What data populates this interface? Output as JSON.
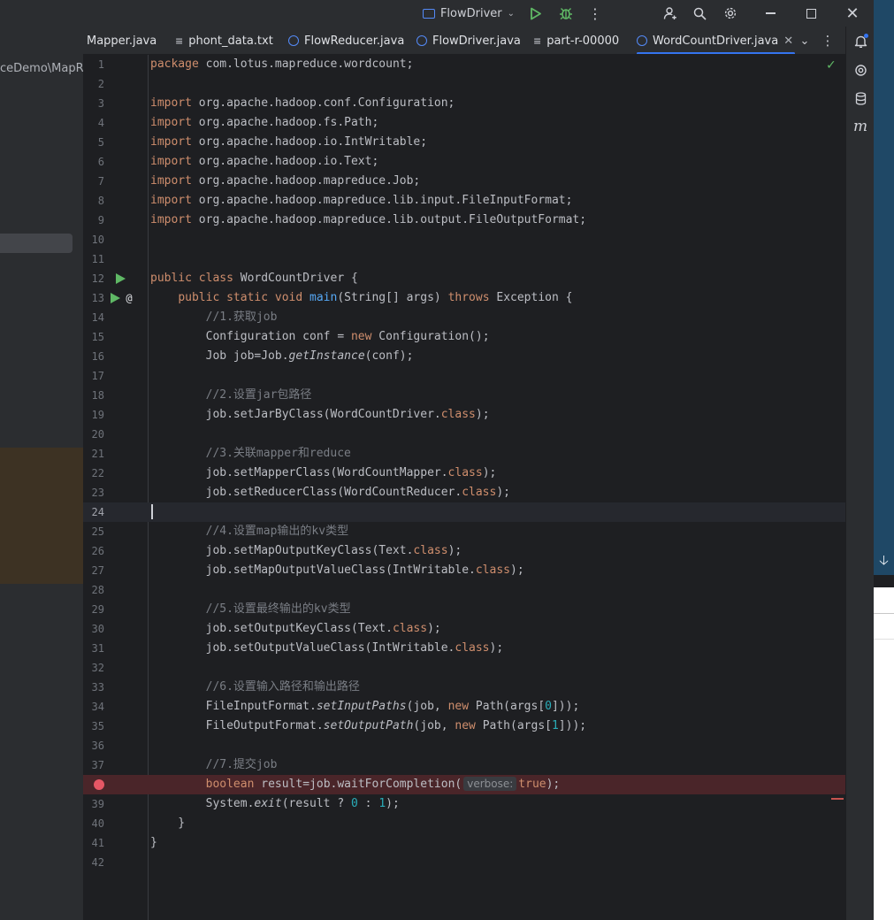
{
  "titlebar": {
    "run_config": "FlowDriver",
    "icons": [
      "run-icon",
      "debug-icon",
      "more-icon",
      "add-user-icon",
      "search-icon",
      "settings-icon",
      "minimize-icon",
      "maximize-icon",
      "close-icon"
    ]
  },
  "project": {
    "path_fragment": "ceDemo\\MapRe"
  },
  "tabs": [
    {
      "label": "Mapper.java",
      "icon": "java-class-icon",
      "active": false
    },
    {
      "label": "phont_data.txt",
      "icon": "text-file-icon",
      "active": false
    },
    {
      "label": "FlowReducer.java",
      "icon": "java-class-icon",
      "active": false
    },
    {
      "label": "FlowDriver.java",
      "icon": "java-class-icon",
      "active": false
    },
    {
      "label": "part-r-00000",
      "icon": "text-file-icon",
      "active": false
    },
    {
      "label": "WordCountDriver.java",
      "icon": "java-class-icon",
      "active": true
    }
  ],
  "editor": {
    "caret_line": 24,
    "breakpoint_line": 38,
    "lines": [
      {
        "n": "1",
        "tokens": [
          [
            "kw",
            "package"
          ],
          [
            "pl",
            " com.lotus.mapreduce.wordcount;"
          ]
        ]
      },
      {
        "n": "2",
        "tokens": []
      },
      {
        "n": "3",
        "tokens": [
          [
            "kw",
            "import"
          ],
          [
            "pl",
            " org.apache.hadoop.conf.Configuration;"
          ]
        ]
      },
      {
        "n": "4",
        "tokens": [
          [
            "kw",
            "import"
          ],
          [
            "pl",
            " org.apache.hadoop.fs.Path;"
          ]
        ]
      },
      {
        "n": "5",
        "tokens": [
          [
            "kw",
            "import"
          ],
          [
            "pl",
            " org.apache.hadoop.io.IntWritable;"
          ]
        ]
      },
      {
        "n": "6",
        "tokens": [
          [
            "kw",
            "import"
          ],
          [
            "pl",
            " org.apache.hadoop.io.Text;"
          ]
        ]
      },
      {
        "n": "7",
        "tokens": [
          [
            "kw",
            "import"
          ],
          [
            "pl",
            " org.apache.hadoop.mapreduce.Job;"
          ]
        ]
      },
      {
        "n": "8",
        "tokens": [
          [
            "kw",
            "import"
          ],
          [
            "pl",
            " org.apache.hadoop.mapreduce.lib.input.FileInputFormat;"
          ]
        ]
      },
      {
        "n": "9",
        "tokens": [
          [
            "kw",
            "import"
          ],
          [
            "pl",
            " org.apache.hadoop.mapreduce.lib.output.FileOutputFormat;"
          ]
        ]
      },
      {
        "n": "10",
        "tokens": []
      },
      {
        "n": "11",
        "tokens": []
      },
      {
        "n": "12",
        "gutter": "run",
        "tokens": [
          [
            "kw",
            "public class"
          ],
          [
            "pl",
            " WordCountDriver {"
          ]
        ]
      },
      {
        "n": "13",
        "gutter": "run-at",
        "tokens": [
          [
            "pl",
            "    "
          ],
          [
            "kw",
            "public static void"
          ],
          [
            "pl",
            " "
          ],
          [
            "fn",
            "main"
          ],
          [
            "pl",
            "(String[] args) "
          ],
          [
            "kw",
            "throws"
          ],
          [
            "pl",
            " Exception {"
          ]
        ]
      },
      {
        "n": "14",
        "tokens": [
          [
            "pl",
            "        "
          ],
          [
            "cm",
            "//1.获取job"
          ]
        ]
      },
      {
        "n": "15",
        "tokens": [
          [
            "pl",
            "        Configuration conf = "
          ],
          [
            "kw",
            "new"
          ],
          [
            "pl",
            " Configuration();"
          ]
        ]
      },
      {
        "n": "16",
        "tokens": [
          [
            "pl",
            "        Job job=Job."
          ],
          [
            "it",
            "getInstance"
          ],
          [
            "pl",
            "(conf);"
          ]
        ]
      },
      {
        "n": "17",
        "tokens": []
      },
      {
        "n": "18",
        "tokens": [
          [
            "pl",
            "        "
          ],
          [
            "cm",
            "//2.设置jar包路径"
          ]
        ]
      },
      {
        "n": "19",
        "tokens": [
          [
            "pl",
            "        job.setJarByClass(WordCountDriver."
          ],
          [
            "kw",
            "class"
          ],
          [
            "pl",
            ");"
          ]
        ]
      },
      {
        "n": "20",
        "tokens": []
      },
      {
        "n": "21",
        "tokens": [
          [
            "pl",
            "        "
          ],
          [
            "cm",
            "//3.关联mapper和reduce"
          ]
        ]
      },
      {
        "n": "22",
        "tokens": [
          [
            "pl",
            "        job.setMapperClass(WordCountMapper."
          ],
          [
            "kw",
            "class"
          ],
          [
            "pl",
            ");"
          ]
        ]
      },
      {
        "n": "23",
        "tokens": [
          [
            "pl",
            "        job.setReducerClass(WordCountReducer."
          ],
          [
            "kw",
            "class"
          ],
          [
            "pl",
            ");"
          ]
        ]
      },
      {
        "n": "24",
        "tokens": []
      },
      {
        "n": "25",
        "tokens": [
          [
            "pl",
            "        "
          ],
          [
            "cm",
            "//4.设置map输出的kv类型"
          ]
        ]
      },
      {
        "n": "26",
        "tokens": [
          [
            "pl",
            "        job.setMapOutputKeyClass(Text."
          ],
          [
            "kw",
            "class"
          ],
          [
            "pl",
            ");"
          ]
        ]
      },
      {
        "n": "27",
        "tokens": [
          [
            "pl",
            "        job.setMapOutputValueClass(IntWritable."
          ],
          [
            "kw",
            "class"
          ],
          [
            "pl",
            ");"
          ]
        ]
      },
      {
        "n": "28",
        "tokens": []
      },
      {
        "n": "29",
        "tokens": [
          [
            "pl",
            "        "
          ],
          [
            "cm",
            "//5.设置最终输出的kv类型"
          ]
        ]
      },
      {
        "n": "30",
        "tokens": [
          [
            "pl",
            "        job.setOutputKeyClass(Text."
          ],
          [
            "kw",
            "class"
          ],
          [
            "pl",
            ");"
          ]
        ]
      },
      {
        "n": "31",
        "tokens": [
          [
            "pl",
            "        job.setOutputValueClass(IntWritable."
          ],
          [
            "kw",
            "class"
          ],
          [
            "pl",
            ");"
          ]
        ]
      },
      {
        "n": "32",
        "tokens": []
      },
      {
        "n": "33",
        "tokens": [
          [
            "pl",
            "        "
          ],
          [
            "cm",
            "//6.设置输入路径和输出路径"
          ]
        ]
      },
      {
        "n": "34",
        "tokens": [
          [
            "pl",
            "        FileInputFormat."
          ],
          [
            "it",
            "setInputPaths"
          ],
          [
            "pl",
            "(job, "
          ],
          [
            "kw",
            "new"
          ],
          [
            "pl",
            " Path(args["
          ],
          [
            "num",
            "0"
          ],
          [
            "pl",
            "]));"
          ]
        ]
      },
      {
        "n": "35",
        "tokens": [
          [
            "pl",
            "        FileOutputFormat."
          ],
          [
            "it",
            "setOutputPath"
          ],
          [
            "pl",
            "(job, "
          ],
          [
            "kw",
            "new"
          ],
          [
            "pl",
            " Path(args["
          ],
          [
            "num",
            "1"
          ],
          [
            "pl",
            "]));"
          ]
        ]
      },
      {
        "n": "36",
        "tokens": []
      },
      {
        "n": "37",
        "tokens": [
          [
            "pl",
            "        "
          ],
          [
            "cm",
            "//7.提交job"
          ]
        ]
      },
      {
        "n": "",
        "gutter": "breakpoint",
        "tokens": [
          [
            "pl",
            "        "
          ],
          [
            "kw",
            "boolean"
          ],
          [
            "pl",
            " result=job.waitForCompletion("
          ],
          [
            "hint",
            "verbose:"
          ],
          [
            "kw",
            "true"
          ],
          [
            "pl",
            ");"
          ]
        ]
      },
      {
        "n": "39",
        "tokens": [
          [
            "pl",
            "        System."
          ],
          [
            "it",
            "exit"
          ],
          [
            "pl",
            "(result ? "
          ],
          [
            "num",
            "0"
          ],
          [
            "pl",
            " : "
          ],
          [
            "num",
            "1"
          ],
          [
            "pl",
            ");"
          ]
        ]
      },
      {
        "n": "40",
        "tokens": [
          [
            "pl",
            "    }"
          ]
        ]
      },
      {
        "n": "41",
        "tokens": [
          [
            "pl",
            "}"
          ]
        ]
      },
      {
        "n": "42",
        "tokens": []
      }
    ]
  },
  "right_strip": {
    "icons": [
      "notifications-icon",
      "ai-assistant-icon",
      "database-icon",
      "maven-icon"
    ],
    "maven_label": "m"
  },
  "colors": {
    "accent": "#3574f0",
    "keyword": "#cf8e6d",
    "method": "#56a8f5",
    "comment": "#7a7e85",
    "number": "#2aacb8",
    "breakpoint": "#e55765",
    "run_green": "#5fb865"
  }
}
